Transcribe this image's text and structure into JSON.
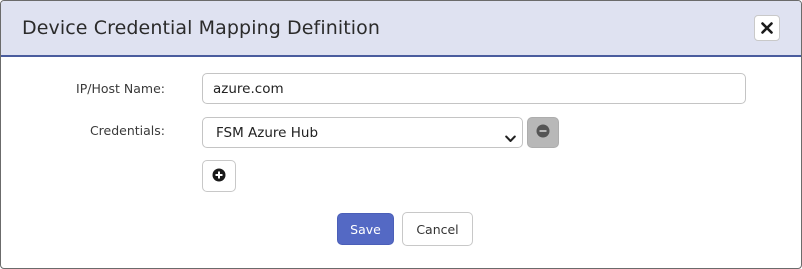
{
  "dialog": {
    "title": "Device Credential Mapping Definition",
    "close_icon": "close-icon"
  },
  "form": {
    "host": {
      "label": "IP/Host Name:",
      "value": "azure.com"
    },
    "credentials": {
      "label": "Credentials:",
      "selected": "FSM Azure Hub",
      "chevron_icon": "chevron-down-icon",
      "remove_icon": "minus-circle-icon"
    },
    "add_icon": "plus-circle-icon"
  },
  "actions": {
    "save_label": "Save",
    "cancel_label": "Cancel"
  },
  "colors": {
    "header_bg": "#dfe2f1",
    "header_border": "#4a5c9e",
    "primary_button": "#5469c4",
    "remove_button": "#b8b8b8"
  }
}
